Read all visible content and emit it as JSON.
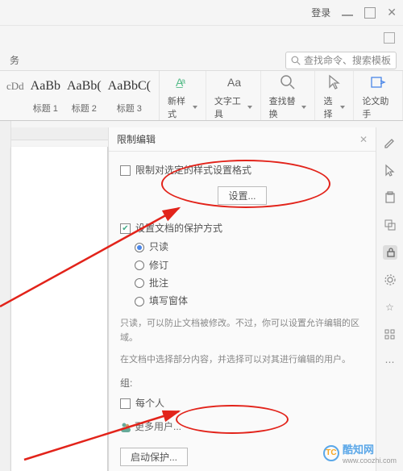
{
  "titlebar": {
    "login_label": "登录"
  },
  "search": {
    "placeholder": "查找命令、搜索模板"
  },
  "ribbon_tab": "务",
  "styles": [
    {
      "preview": "cDd",
      "label": ""
    },
    {
      "preview": "AaBb",
      "label": "标题 1"
    },
    {
      "preview": "AaBb(",
      "label": "标题 2"
    },
    {
      "preview": "AaBbC(",
      "label": "标题 3"
    }
  ],
  "ribbon_buttons": {
    "new_style": "新样式",
    "text_tool": "文字工具",
    "find_replace": "查找替换",
    "select": "选择",
    "thesis": "论文助手"
  },
  "panel": {
    "title": "限制编辑",
    "opt_format": "限制对选定的样式设置格式",
    "settings_btn": "设置...",
    "opt_protect": "设置文档的保护方式",
    "radios": {
      "readonly": "只读",
      "revise": "修订",
      "comment": "批注",
      "form": "填写窗体"
    },
    "desc1": "只读，可以防止文档被修改。不过，你可以设置允许编辑的区域。",
    "desc2": "在文档中选择部分内容，并选择可以对其进行编辑的用户。",
    "group_label": "组:",
    "everyone": "每个人",
    "more_users": "更多用户...",
    "start_protect": "启动保护..."
  },
  "watermark": {
    "brand": "酷知网",
    "domain": "www.coozhi.com",
    "logo_text": "TC"
  }
}
